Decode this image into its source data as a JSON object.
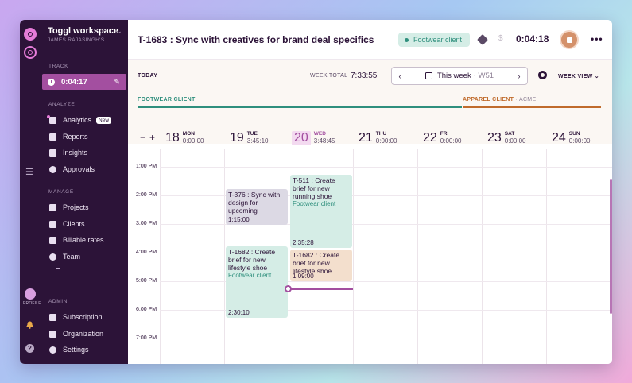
{
  "workspace": {
    "name": "Toggl workspace",
    "user": "JAMES RAJASINGH'S ..."
  },
  "sidebar": {
    "track_label": "TRACK",
    "current_timer": "0:04:17",
    "analyze_label": "ANALYZE",
    "analyze_items": [
      {
        "label": "Analytics",
        "badge": "New"
      },
      {
        "label": "Reports"
      },
      {
        "label": "Insights"
      },
      {
        "label": "Approvals"
      }
    ],
    "manage_label": "MANAGE",
    "manage_items": [
      {
        "label": "Projects"
      },
      {
        "label": "Clients"
      },
      {
        "label": "Billable rates"
      },
      {
        "label": "Team"
      }
    ],
    "admin_label": "ADMIN",
    "admin_items": [
      {
        "label": "Subscription"
      },
      {
        "label": "Organization"
      },
      {
        "label": "Settings"
      }
    ],
    "profile_label": "PROFILE"
  },
  "header": {
    "entry_title": "T-1683 : Sync with creatives for brand deal specifics",
    "project": "Footwear client",
    "running_time": "0:04:18"
  },
  "toolbar": {
    "today": "TODAY",
    "week_total_label": "WEEK TOTAL",
    "week_total": "7:33:55",
    "week_label": "This week",
    "week_code": "· W51",
    "view": "WEEK VIEW"
  },
  "clients": {
    "left": "FOOTWEAR CLIENT",
    "right": "APPAREL CLIENT",
    "right_sub": "ACME"
  },
  "days": [
    {
      "num": "18",
      "name": "MON",
      "total": "0:00:00"
    },
    {
      "num": "19",
      "name": "TUE",
      "total": "3:45:10"
    },
    {
      "num": "20",
      "name": "WED",
      "total": "3:48:45"
    },
    {
      "num": "21",
      "name": "THU",
      "total": "0:00:00"
    },
    {
      "num": "22",
      "name": "FRI",
      "total": "0:00:00"
    },
    {
      "num": "23",
      "name": "SAT",
      "total": "0:00:00"
    },
    {
      "num": "24",
      "name": "SUN",
      "total": "0:00:00"
    }
  ],
  "hours": [
    "1:00 PM",
    "2:00 PM",
    "3:00 PM",
    "4:00 PM",
    "5:00 PM",
    "6:00 PM",
    "7:00 PM"
  ],
  "events": [
    {
      "title": "T-376 : Sync with design for upcoming",
      "project": "",
      "duration": "1:15:00"
    },
    {
      "title": "T-1682 : Create brief for new lifestyle shoe",
      "project": "Footwear client",
      "duration": "2:30:10"
    },
    {
      "title": "T-511 : Create brief for new running shoe",
      "project": "Footwear client",
      "duration": "2:35:28"
    },
    {
      "title": "T-1682 : Create brief for new lifestyle shoe",
      "project": "",
      "duration": "1:09:00"
    }
  ],
  "colors": {
    "accent": "#a34fa0",
    "sidebar": "#2c1338",
    "footwear": "#2f8f7d",
    "apparel": "#c06b2c"
  }
}
